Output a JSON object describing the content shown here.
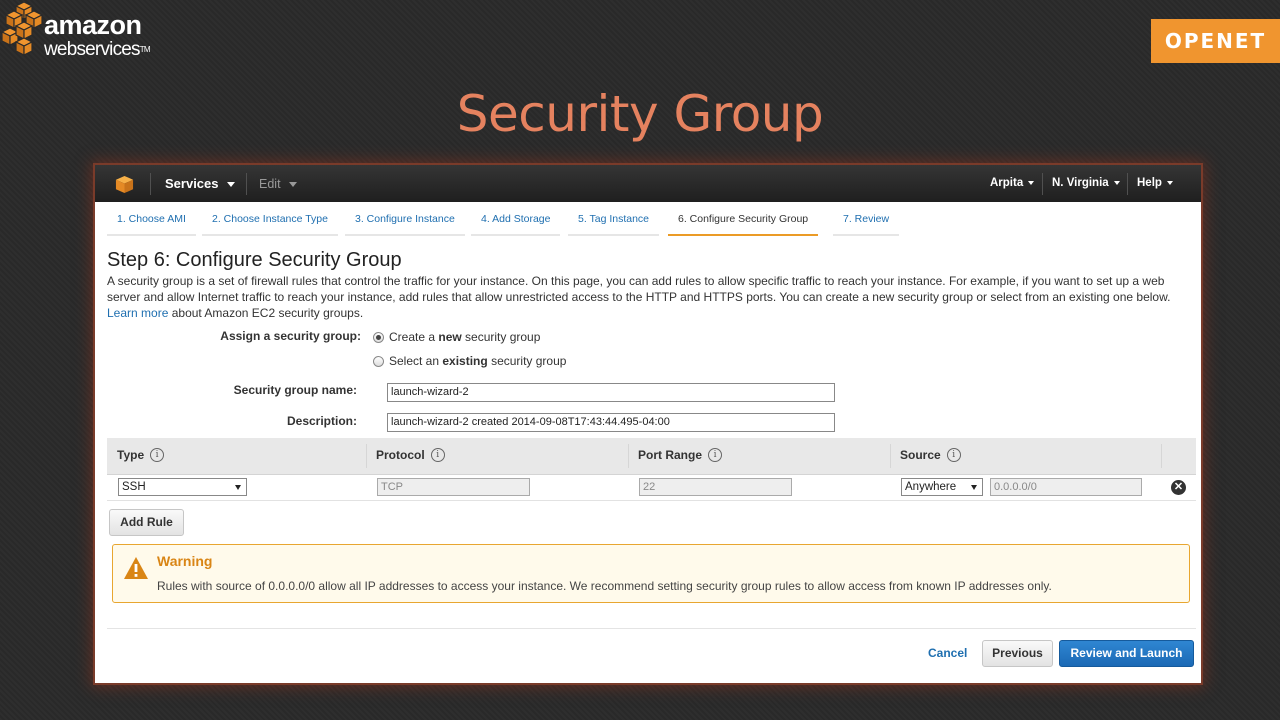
{
  "brand": {
    "aws_line1": "amazon",
    "aws_line2": "webservices",
    "aws_tm": "TM",
    "partner": "OPENET",
    "partner_color": "#f0952f"
  },
  "slide": {
    "title": "Security Group",
    "title_color": "#e5825f"
  },
  "topbar": {
    "logo_icon": "aws-cube-icon",
    "services": "Services",
    "edit": "Edit",
    "user": "Arpita",
    "region": "N. Virginia",
    "help": "Help"
  },
  "wizard": {
    "steps": [
      {
        "label": "1. Choose AMI",
        "active": false
      },
      {
        "label": "2. Choose Instance Type",
        "active": false
      },
      {
        "label": "3. Configure Instance",
        "active": false
      },
      {
        "label": "4. Add Storage",
        "active": false
      },
      {
        "label": "5. Tag Instance",
        "active": false
      },
      {
        "label": "6. Configure Security Group",
        "active": true
      },
      {
        "label": "7. Review",
        "active": false
      }
    ],
    "heading": "Step 6: Configure Security Group",
    "intro_text": "A security group is a set of firewall rules that control the traffic for your instance. On this page, you can add rules to allow specific traffic to reach your instance. For example, if you want to set up a web server and allow Internet traffic to reach your instance, add rules that allow unrestricted access to the HTTP and HTTPS ports. You can create a new security group or select from an existing one below.",
    "learn_more": "Learn more",
    "intro_suffix": "about Amazon EC2 security groups."
  },
  "form": {
    "assign_label": "Assign a security group:",
    "option_new_pre": "Create a ",
    "option_new_bold": "new",
    "option_new_post": " security group",
    "option_existing_pre": "Select an ",
    "option_existing_bold": "existing",
    "option_existing_post": " security group",
    "selected_option": "new",
    "name_label": "Security group name:",
    "name_value": "launch-wizard-2",
    "desc_label": "Description:",
    "desc_value": "launch-wizard-2 created 2014-09-08T17:43:44.495-04:00"
  },
  "rules": {
    "headers": {
      "type": "Type",
      "protocol": "Protocol",
      "port": "Port Range",
      "source": "Source"
    },
    "info_glyph": "i",
    "row": {
      "type": "SSH",
      "protocol": "TCP",
      "port": "22",
      "source_select": "Anywhere",
      "source_cidr": "0.0.0.0/0",
      "remove_glyph": "✕"
    },
    "add_rule": "Add Rule"
  },
  "warning": {
    "title": "Warning",
    "text": "Rules with source of 0.0.0.0/0 allow all IP addresses to access your instance. We recommend setting security group rules to allow access from known IP addresses only.",
    "color": "#e8a630"
  },
  "footer": {
    "cancel": "Cancel",
    "previous": "Previous",
    "review_launch": "Review and Launch",
    "primary_color": "#1f6fb0"
  }
}
